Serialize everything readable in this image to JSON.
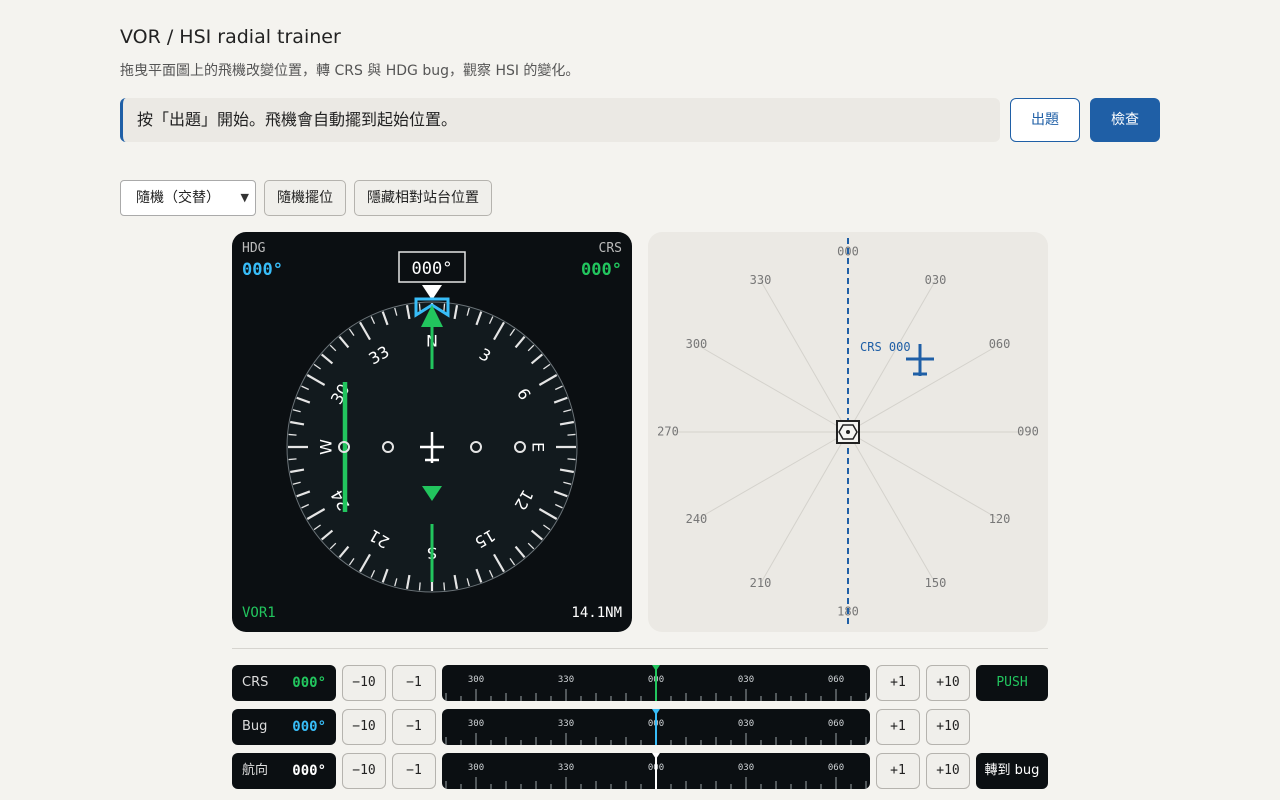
{
  "header": {
    "title": "VOR / HSI radial trainer",
    "subtitle": "拖曳平面圖上的飛機改變位置，轉 CRS 與 HDG bug，觀察 HSI 的變化。"
  },
  "message": "按「出題」開始。飛機會自動擺到起始位置。",
  "actions": {
    "new_question": "出題",
    "check": "檢查"
  },
  "toolbar": {
    "mode_select": "隨機（交替）",
    "random_position": "隨機擺位",
    "hide_relative": "隱藏相對站台位置"
  },
  "hsi": {
    "hdg_label": "HDG",
    "hdg_value": "000°",
    "crs_label": "CRS",
    "crs_value": "000°",
    "heading_box": "000°",
    "source": "VOR1",
    "distance": "14.1NM",
    "card_labels": [
      "N",
      "3",
      "6",
      "E",
      "12",
      "15",
      "S",
      "21",
      "24",
      "W",
      "30",
      "33"
    ],
    "course_deviation_dots": 0
  },
  "map": {
    "radial_labels": [
      "000",
      "030",
      "060",
      "090",
      "120",
      "150",
      "180",
      "210",
      "240",
      "270",
      "300",
      "330"
    ],
    "crs_label": "CRS 000"
  },
  "controls": [
    {
      "name": "CRS",
      "value": "000°",
      "color": "#22c55e"
    },
    {
      "name": "Bug",
      "value": "000°",
      "color": "#38bdf8"
    },
    {
      "name": "航向",
      "value": "000°",
      "color": "#ffffff"
    }
  ],
  "steps": {
    "minus10": "−10",
    "minus1": "−1",
    "plus1": "+1",
    "plus10": "+10"
  },
  "tape_labels": [
    "300",
    "330",
    "000",
    "030",
    "060"
  ],
  "push_label": "PUSH",
  "goto_bug_label": "轉到 bug",
  "colors": {
    "accent": "#1f5fa6",
    "crs_green": "#22c55e",
    "bug_cyan": "#38bdf8"
  }
}
